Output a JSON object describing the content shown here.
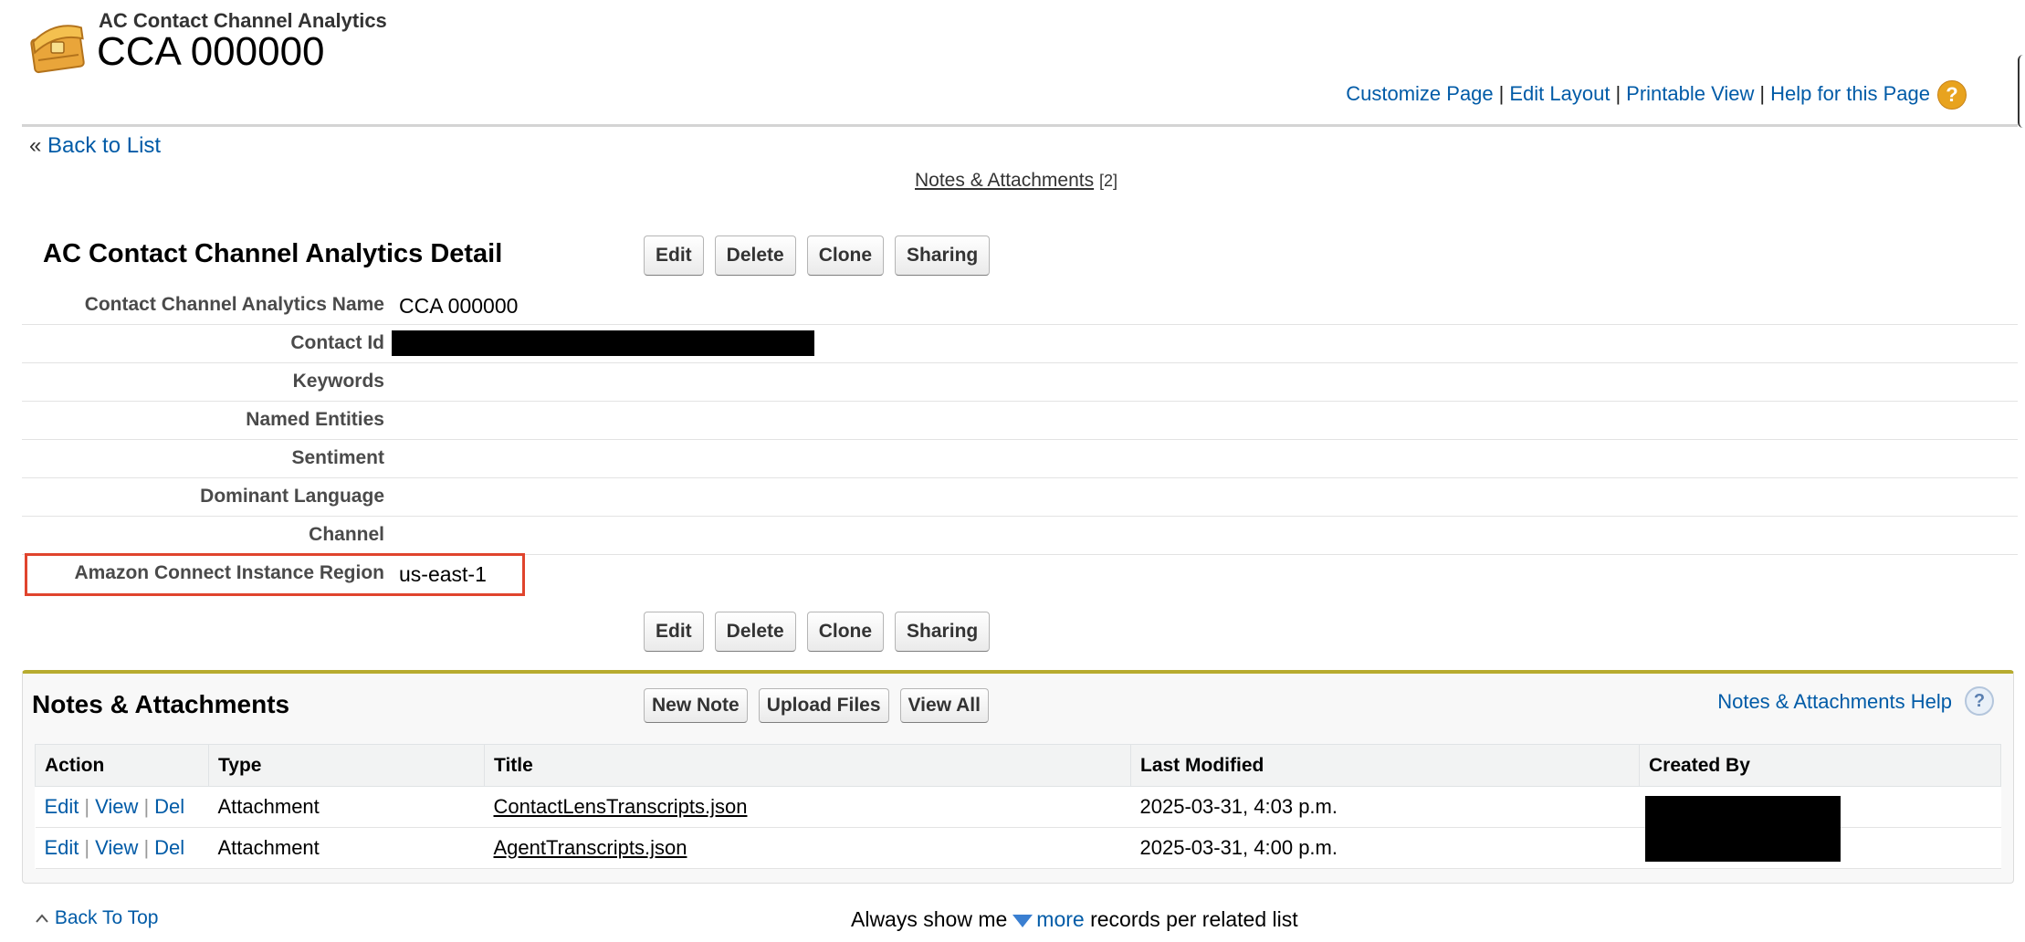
{
  "header": {
    "object_type": "AC Contact Channel Analytics",
    "record_name": "CCA 000000",
    "icon": "treasure-chest-icon"
  },
  "top_links": {
    "customize": "Customize Page",
    "edit_layout": "Edit Layout",
    "printable": "Printable View",
    "help": "Help for this Page",
    "separator": "|",
    "help_icon_glyph": "?"
  },
  "nav": {
    "back_prefix": "«",
    "back_to_list": "Back to List",
    "notes_anchor": "Notes & Attachments",
    "notes_count": "[2]"
  },
  "detail": {
    "title": "AC Contact Channel Analytics Detail",
    "buttons": {
      "edit": "Edit",
      "delete": "Delete",
      "clone": "Clone",
      "sharing": "Sharing"
    },
    "fields": [
      {
        "label": "Contact Channel Analytics Name",
        "value": "CCA 000000"
      },
      {
        "label": "Contact Id",
        "value": ""
      },
      {
        "label": "Keywords",
        "value": ""
      },
      {
        "label": "Named Entities",
        "value": ""
      },
      {
        "label": "Sentiment",
        "value": ""
      },
      {
        "label": "Dominant Language",
        "value": ""
      },
      {
        "label": "Channel",
        "value": ""
      },
      {
        "label": "Amazon Connect Instance Region",
        "value": "us-east-1"
      }
    ],
    "highlight_color": "#e0442d"
  },
  "related": {
    "title": "Notes & Attachments",
    "buttons": {
      "new_note": "New Note",
      "upload": "Upload Files",
      "view_all": "View All"
    },
    "help_link": "Notes & Attachments Help",
    "help_icon_glyph": "?",
    "columns": [
      "Action",
      "Type",
      "Title",
      "Last Modified",
      "Created By"
    ],
    "action_links": {
      "edit": "Edit",
      "view": "View",
      "del": "Del",
      "sep": "|"
    },
    "rows": [
      {
        "type": "Attachment",
        "title": "ContactLensTranscripts.json",
        "modified": "2025-03-31, 4:03 p.m.",
        "created_by": ""
      },
      {
        "type": "Attachment",
        "title": "AgentTranscripts.json",
        "modified": "2025-03-31, 4:00 p.m.",
        "created_by": ""
      }
    ],
    "accent_color": "#b7ab2f"
  },
  "footer": {
    "back_to_top": "Back To Top",
    "always_show": "Always show me",
    "more": "more",
    "per_list": "records per related list"
  },
  "colors": {
    "link": "#015ba7"
  }
}
